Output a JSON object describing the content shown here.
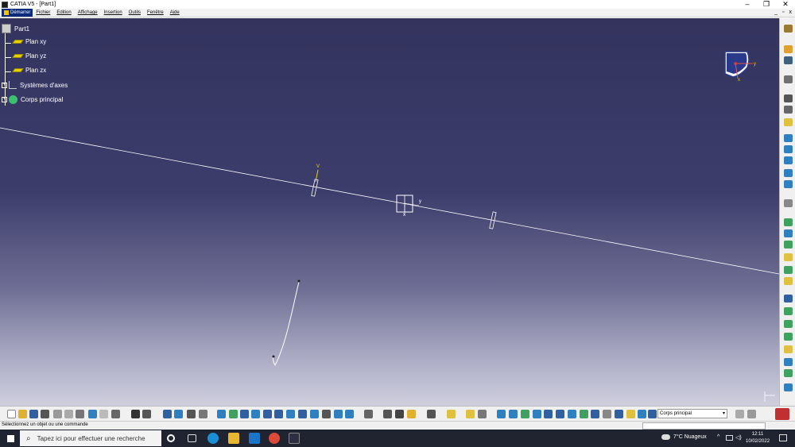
{
  "window": {
    "title": "CATIA V5 - [Part1]",
    "controls": [
      "–",
      "❐",
      "✕"
    ],
    "mdi_controls": [
      "_",
      "▫",
      "x"
    ]
  },
  "menu": {
    "start": "Démarrer",
    "items": [
      "Fichier",
      "Edition",
      "Affichage",
      "Insertion",
      "Outils",
      "Fenêtre",
      "Aide"
    ]
  },
  "tree": {
    "root": "Part1",
    "items": [
      "Plan xy",
      "Plan yz",
      "Plan zx",
      "Systèmes d'axes",
      "Corps principal"
    ]
  },
  "axis_labels": {
    "compass_y": "y",
    "compass_x": "x",
    "plane_v": "V",
    "sketch_y": "y",
    "sketch_x": "x"
  },
  "toolbar": {
    "current_body": "Corps principal"
  },
  "status": {
    "message": "Sélectionnez un objet ou une commande"
  },
  "taskbar": {
    "search_placeholder": "Tapez ici pour effectuer une recherche",
    "weather": "7°C Nuageux",
    "time": "12:11",
    "date": "10/02/2022"
  },
  "colors": {
    "viewport_top": "#33335e",
    "viewport_bottom": "#cfcfdf",
    "plane_yellow": "#e8d000",
    "taskbar": "#1f2430"
  }
}
